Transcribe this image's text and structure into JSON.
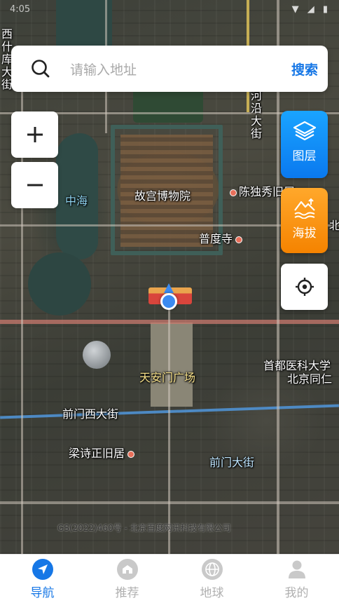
{
  "status_bar": {
    "time": "4:05",
    "icons": "▼ ◢ ▮"
  },
  "search": {
    "placeholder": "请输入地址",
    "button": "搜索"
  },
  "zoom": {
    "in": "+",
    "out": "−"
  },
  "tools": {
    "layers_label": "图层",
    "altitude_label": "海拔"
  },
  "map": {
    "labels": {
      "forbidden_city": "故宫博物院",
      "zhonghai": "中海",
      "chenduxiu": "陈独秀旧居",
      "pudu_temple": "普度寺",
      "tiananmen_square": "天安门广场",
      "capital_medical": "首都医科大学",
      "beijing_tongren": "北京同仁",
      "qianmen_west": "前门西大街",
      "liangshizheng": "梁诗正旧居",
      "qianmen_street": "前门大街",
      "nanheyan": "河沿大街",
      "left_vertical": "西什库大街",
      "right_edge": "北京"
    },
    "copyright": "GS(2022)460号 - 北京百度网讯科技有限公司"
  },
  "tabs": [
    {
      "label": "导航",
      "icon": "navigation-icon",
      "active": true
    },
    {
      "label": "推荐",
      "icon": "recommend-icon",
      "active": false
    },
    {
      "label": "地球",
      "icon": "globe-icon",
      "active": false
    },
    {
      "label": "我的",
      "icon": "user-icon",
      "active": false
    }
  ],
  "colors": {
    "accent": "#1677e6",
    "layers_button": "#0a79ef",
    "altitude_button": "#f58300"
  }
}
